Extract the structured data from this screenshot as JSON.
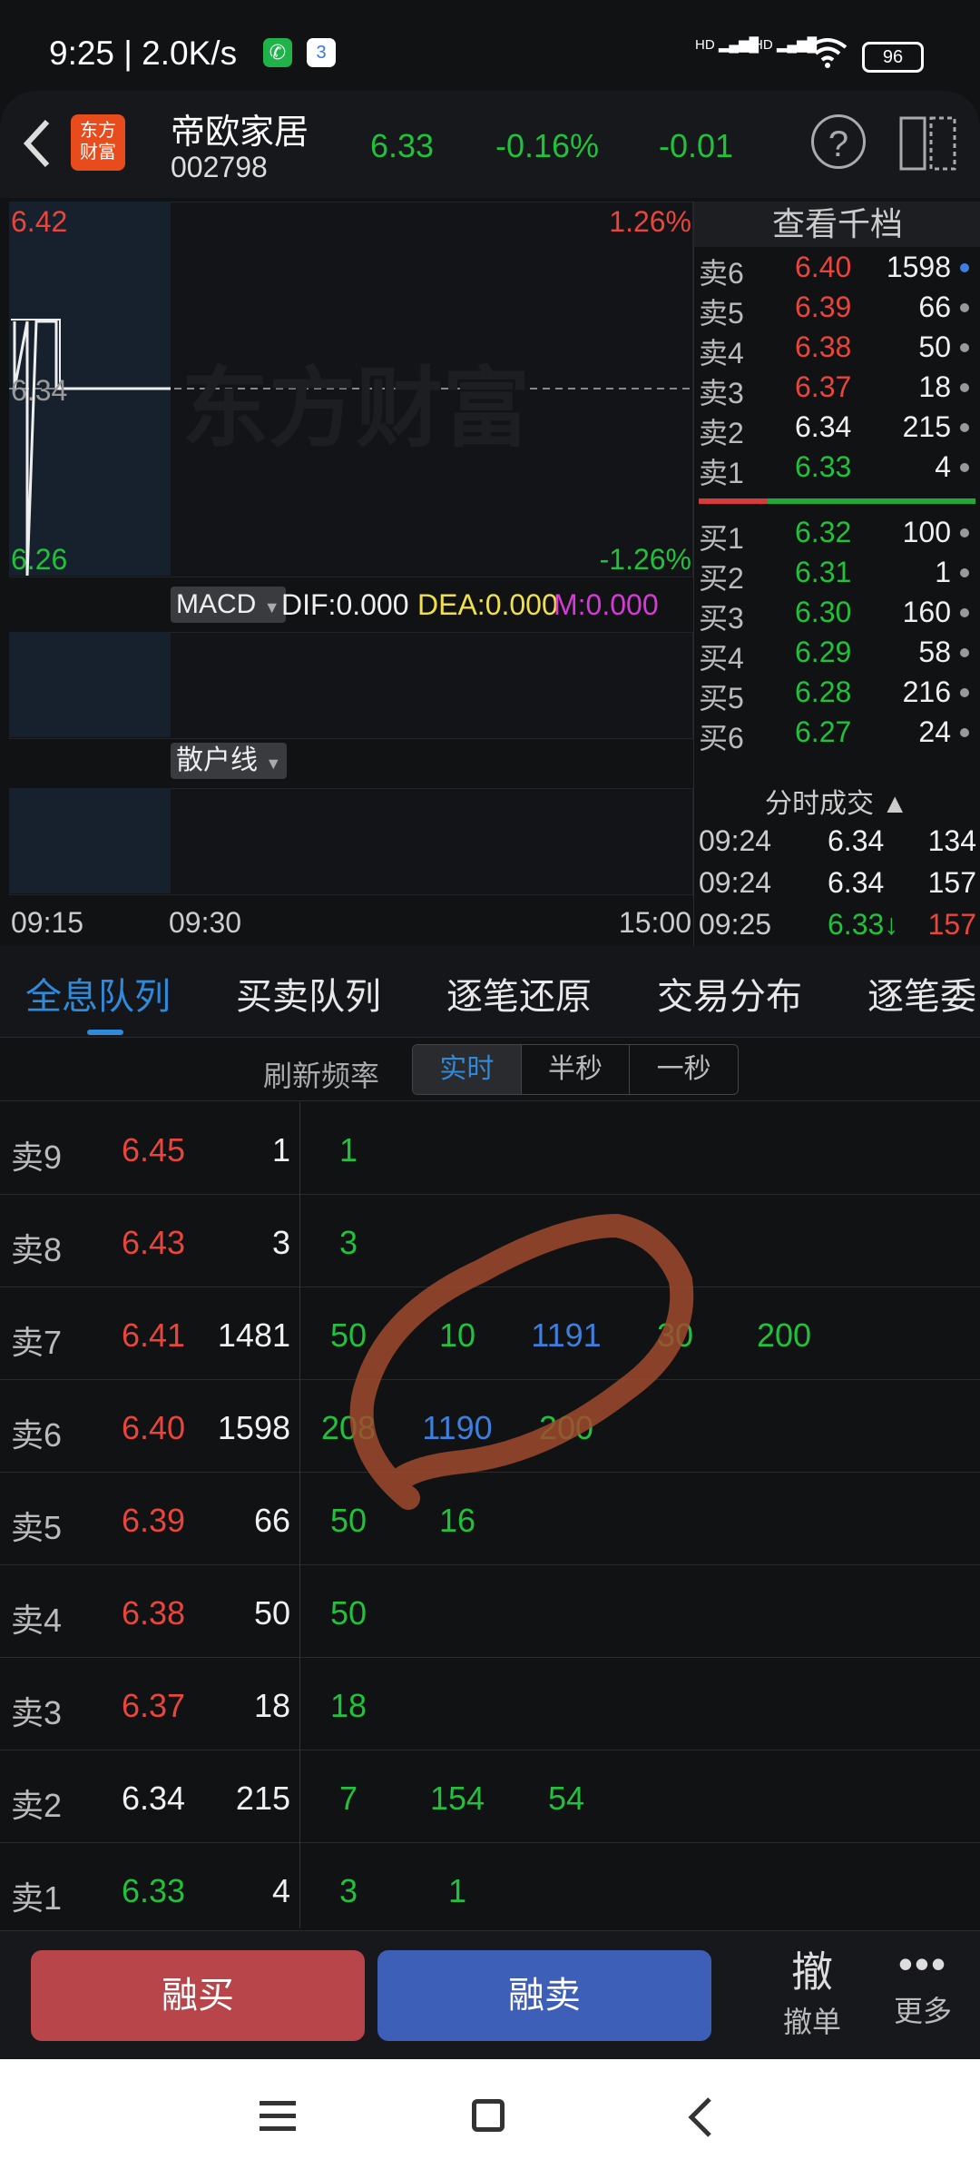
{
  "status_bar": {
    "time": "9:25 | 2.0K/s",
    "battery": "96",
    "signal1": "HD",
    "signal2": "HD"
  },
  "header": {
    "stock_name": "帝欧家居",
    "stock_code": "002798",
    "price": "6.33",
    "change_pct": "-0.16%",
    "change": "-0.01",
    "logo_line1": "东方",
    "logo_line2": "财富"
  },
  "chart": {
    "top_price": "6.42",
    "top_pct": "1.26%",
    "mid_price": "6.34",
    "bottom_price": "6.26",
    "bottom_pct": "-1.26%",
    "watermark": "东方财富",
    "macd_label": "MACD",
    "dif": "DIF:0.000",
    "dea": "DEA:0.000",
    "m": "M:0.000",
    "retail_label": "散户线",
    "time_axis": [
      "09:15",
      "09:30",
      "15:00"
    ]
  },
  "order_book": {
    "title": "查看千档",
    "asks": [
      {
        "label": "卖6",
        "price": "6.40",
        "vol": "1598",
        "pc": "red"
      },
      {
        "label": "卖5",
        "price": "6.39",
        "vol": "66",
        "pc": "red"
      },
      {
        "label": "卖4",
        "price": "6.38",
        "vol": "50",
        "pc": "red"
      },
      {
        "label": "卖3",
        "price": "6.37",
        "vol": "18",
        "pc": "red"
      },
      {
        "label": "卖2",
        "price": "6.34",
        "vol": "215",
        "pc": "white"
      },
      {
        "label": "卖1",
        "price": "6.33",
        "vol": "4",
        "pc": "green"
      }
    ],
    "bids": [
      {
        "label": "买1",
        "price": "6.32",
        "vol": "100"
      },
      {
        "label": "买2",
        "price": "6.31",
        "vol": "1"
      },
      {
        "label": "买3",
        "price": "6.30",
        "vol": "160"
      },
      {
        "label": "买4",
        "price": "6.29",
        "vol": "58"
      },
      {
        "label": "买5",
        "price": "6.28",
        "vol": "216"
      },
      {
        "label": "买6",
        "price": "6.27",
        "vol": "24"
      }
    ],
    "trades_title": "分时成交",
    "trades": [
      {
        "time": "09:24",
        "price": "6.34",
        "vol": "134"
      },
      {
        "time": "09:24",
        "price": "6.34",
        "vol": "157"
      },
      {
        "time": "09:25",
        "price": "6.33↓",
        "vol": "157"
      }
    ]
  },
  "tabs": [
    "全息队列",
    "买卖队列",
    "逐笔还原",
    "交易分布",
    "逐笔委"
  ],
  "refresh": {
    "label": "刷新频率",
    "options": [
      "实时",
      "半秒",
      "一秒"
    ]
  },
  "queue": [
    {
      "label": "卖9",
      "price": "6.45",
      "pc": "red",
      "total": "1",
      "orders": [
        "1"
      ]
    },
    {
      "label": "卖8",
      "price": "6.43",
      "pc": "red",
      "total": "3",
      "orders": [
        "3"
      ]
    },
    {
      "label": "卖7",
      "price": "6.41",
      "pc": "red",
      "total": "1481",
      "orders": [
        "50",
        "10",
        "1191",
        "30",
        "200"
      ]
    },
    {
      "label": "卖6",
      "price": "6.40",
      "pc": "red",
      "total": "1598",
      "orders": [
        "208",
        "1190",
        "200"
      ]
    },
    {
      "label": "卖5",
      "price": "6.39",
      "pc": "red",
      "total": "66",
      "orders": [
        "50",
        "16"
      ]
    },
    {
      "label": "卖4",
      "price": "6.38",
      "pc": "red",
      "total": "50",
      "orders": [
        "50"
      ]
    },
    {
      "label": "卖3",
      "price": "6.37",
      "pc": "red",
      "total": "18",
      "orders": [
        "18"
      ]
    },
    {
      "label": "卖2",
      "price": "6.34",
      "pc": "white",
      "total": "215",
      "orders": [
        "7",
        "154",
        "54"
      ]
    },
    {
      "label": "卖1",
      "price": "6.33",
      "pc": "green",
      "total": "4",
      "orders": [
        "3",
        "1"
      ]
    }
  ],
  "actions": {
    "margin_buy": "融买",
    "margin_sell": "融卖",
    "cancel_icon": "撤",
    "cancel": "撤单",
    "more": "更多"
  },
  "colors": {
    "red": "#e8453c",
    "green": "#21c13b",
    "blue": "#3f7fdc",
    "buy_btn": "#b8454a",
    "sell_btn": "#3d5fb8"
  }
}
